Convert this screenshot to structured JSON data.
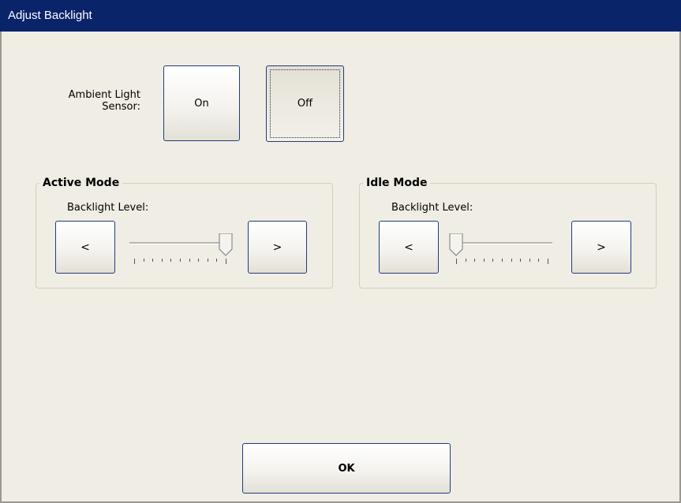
{
  "window": {
    "title": "Adjust Backlight"
  },
  "sensor": {
    "label_line1": "Ambient Light",
    "label_line2": "Sensor:",
    "on_label": "On",
    "off_label": "Off",
    "selected": "Off"
  },
  "active_mode": {
    "title": "Active Mode",
    "level_label": "Backlight Level:",
    "decrease_label": "<",
    "increase_label": ">",
    "level": 1.0
  },
  "idle_mode": {
    "title": "Idle Mode",
    "level_label": "Backlight Level:",
    "decrease_label": "<",
    "increase_label": ">",
    "level": 0.0
  },
  "ok_label": "OK"
}
